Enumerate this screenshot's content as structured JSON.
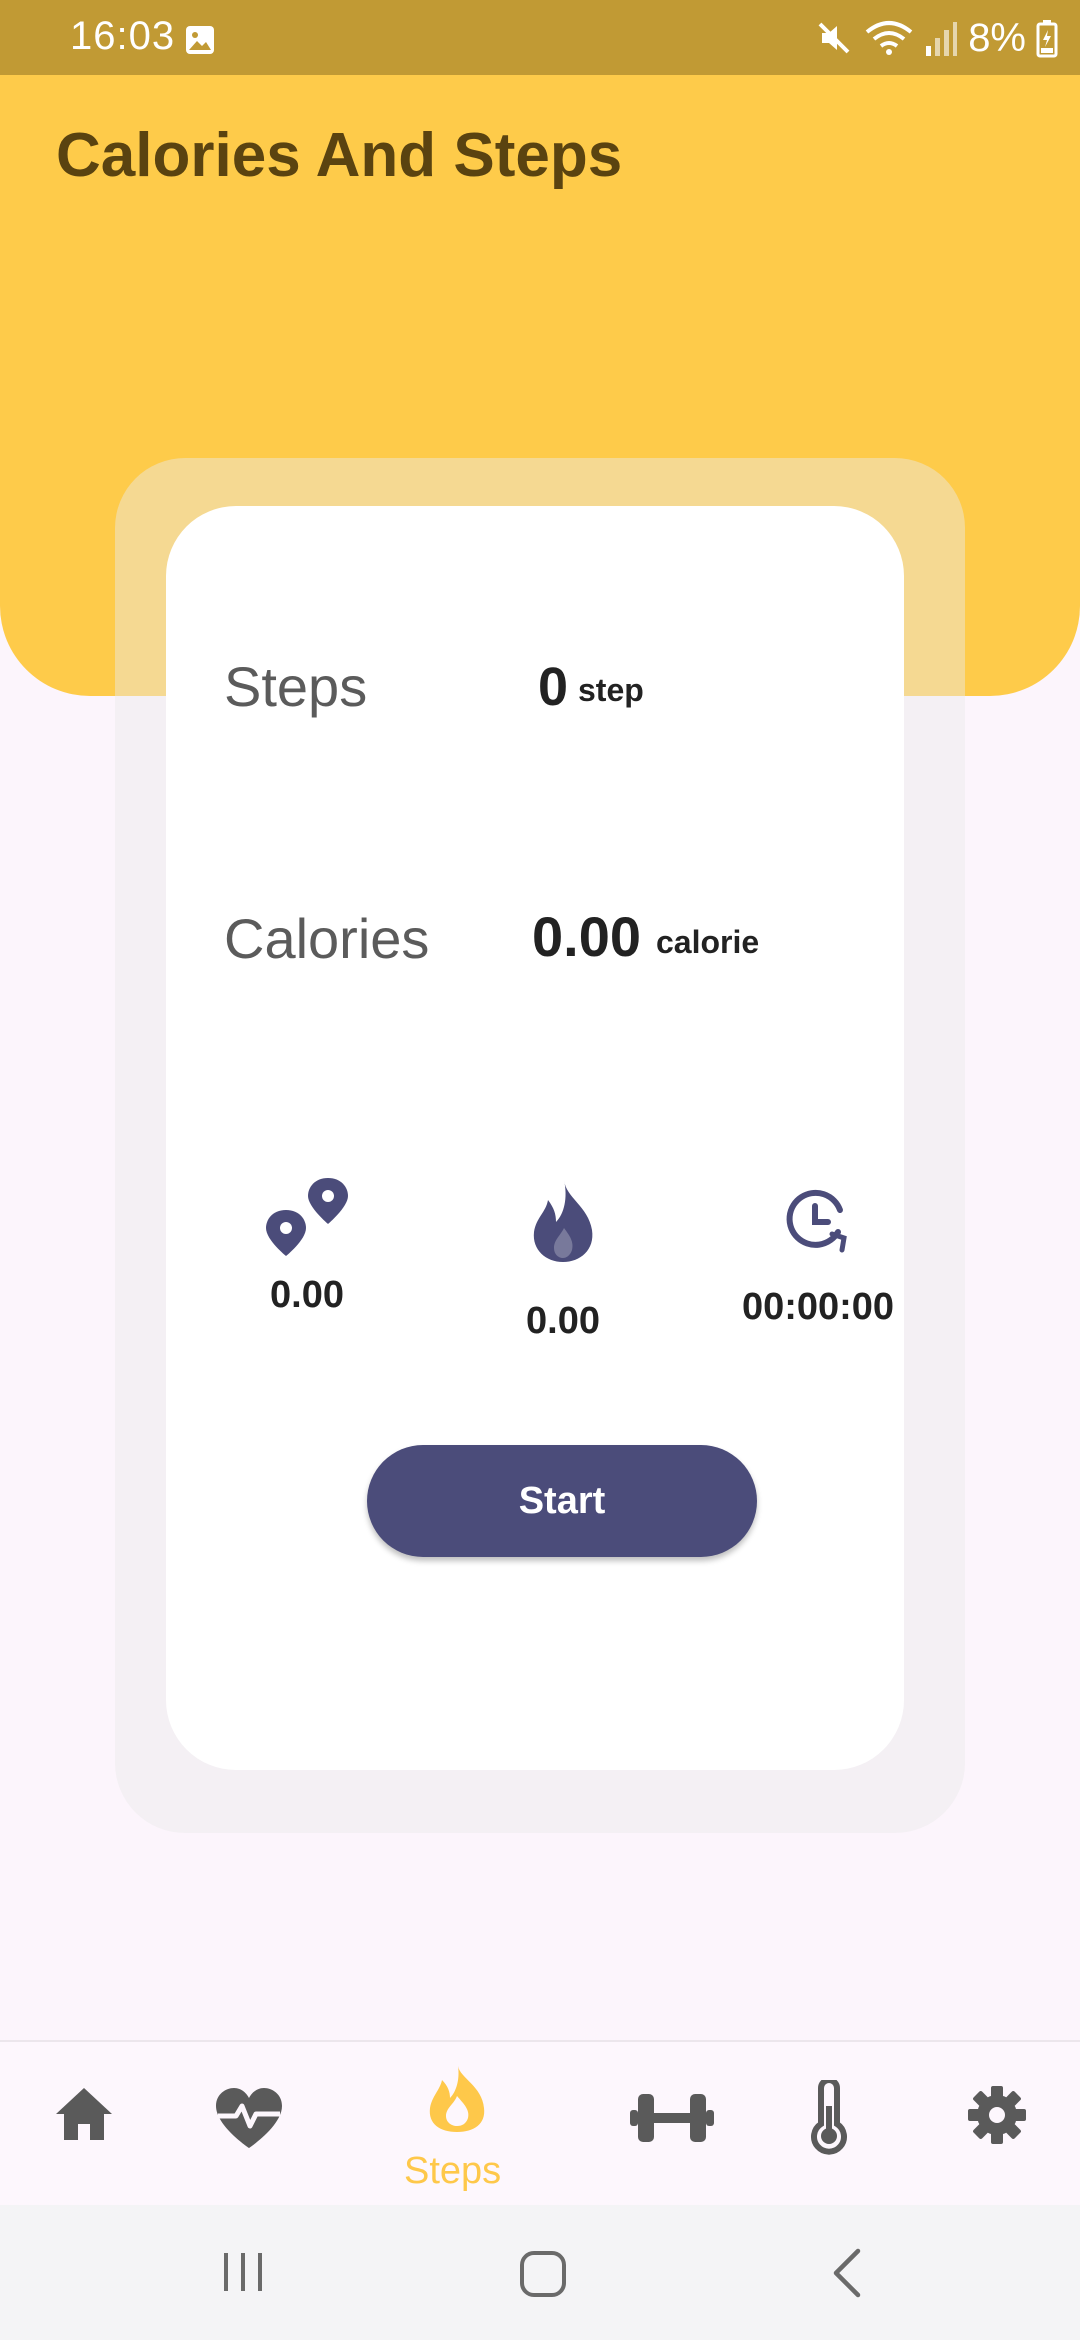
{
  "status_bar": {
    "time": "16:03",
    "battery": "8%",
    "icons": [
      "gallery-icon",
      "mute-icon",
      "wifi-icon",
      "signal-icon",
      "battery-icon"
    ]
  },
  "header": {
    "title": "Calories And Steps"
  },
  "card": {
    "steps": {
      "label": "Steps",
      "value": "0",
      "unit": "step"
    },
    "calories": {
      "label": "Calories",
      "value": "0.00",
      "unit": "calorie"
    },
    "stats": [
      {
        "icon": "location-pins-icon",
        "value": "0.00"
      },
      {
        "icon": "flame-icon",
        "value": "0.00"
      },
      {
        "icon": "timer-icon",
        "value": "00:00:00"
      }
    ],
    "start_label": "Start"
  },
  "bottom_nav": {
    "items": [
      {
        "icon": "home-icon"
      },
      {
        "icon": "heart-rate-icon"
      },
      {
        "icon": "flame-icon",
        "label": "Steps",
        "active": true
      },
      {
        "icon": "dumbbell-icon"
      },
      {
        "icon": "thermometer-icon"
      },
      {
        "icon": "gear-icon"
      }
    ]
  },
  "colors": {
    "status_bar": "#c19a34",
    "header": "#fecb4a",
    "title": "#5a4310",
    "accent": "#4b4c7a",
    "active_nav": "#fec84a",
    "nav_icon": "#5a5a5a"
  }
}
